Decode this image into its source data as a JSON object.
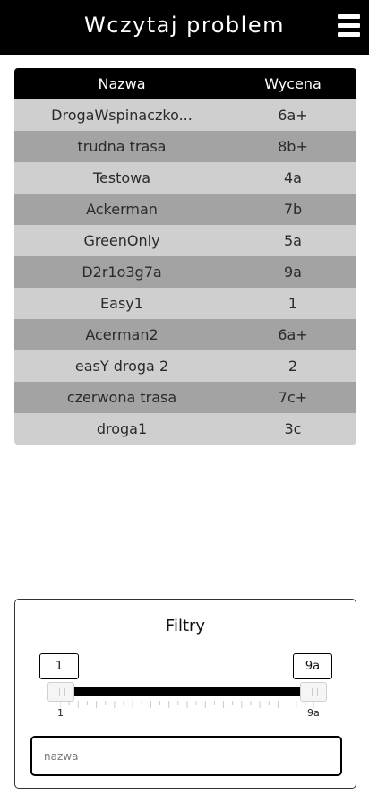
{
  "header": {
    "title": "Wczytaj problem"
  },
  "table": {
    "columns": [
      "Nazwa",
      "Wycena"
    ],
    "rows": [
      {
        "name": "DrogaWspinaczko...",
        "grade": "6a+"
      },
      {
        "name": "trudna trasa",
        "grade": "8b+"
      },
      {
        "name": "Testowa",
        "grade": "4a"
      },
      {
        "name": "Ackerman",
        "grade": "7b"
      },
      {
        "name": "GreenOnly",
        "grade": "5a"
      },
      {
        "name": "D2r1o3g7a",
        "grade": "9a"
      },
      {
        "name": "Easy1",
        "grade": "1"
      },
      {
        "name": "Acerman2",
        "grade": "6a+"
      },
      {
        "name": "easY droga 2",
        "grade": "2"
      },
      {
        "name": "czerwona trasa",
        "grade": "7c+"
      },
      {
        "name": "droga1",
        "grade": "3c"
      }
    ]
  },
  "filters": {
    "title": "Filtry",
    "range": {
      "min_value": "1",
      "max_value": "9a",
      "min_label": "1",
      "max_label": "9a"
    },
    "name_input": {
      "placeholder": "nazwa",
      "value": ""
    }
  },
  "colors": {
    "header_bg": "#000000",
    "row_light": "#cfcfcf",
    "row_dark": "#a3a3a3",
    "slider_bar": "#000000"
  },
  "icons": {
    "menu": "hamburger-menu-icon"
  }
}
